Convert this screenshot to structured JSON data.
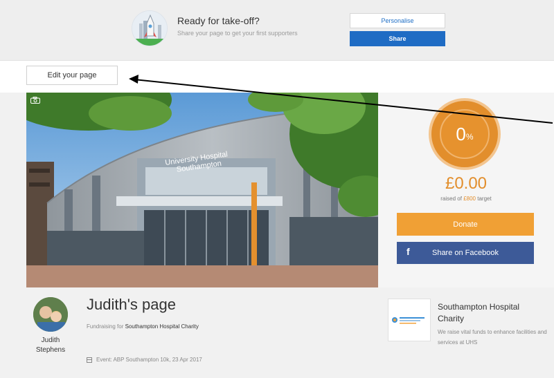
{
  "banner": {
    "title": "Ready for take-off?",
    "subtitle": "Share your page to get your first supporters",
    "personalise_label": "Personalise",
    "share_label": "Share"
  },
  "editbar": {
    "edit_label": "Edit your page"
  },
  "hero": {
    "building_sign_line1": "University Hospital",
    "building_sign_line2": "Southampton"
  },
  "stats": {
    "percent": "0",
    "percent_symbol": "%",
    "amount": "£0.00",
    "raised_prefix": "raised of",
    "target": "£800",
    "raised_suffix": "target",
    "donate_label": "Donate",
    "facebook_label": "Share on Facebook",
    "facebook_glyph": "f"
  },
  "profile": {
    "owner_name": "Judith Stephens",
    "page_title": "Judith's page",
    "fund_prefix": "Fundraising for",
    "charity": "Southampton Hospital Charity",
    "event": "Event: ABP Southampton 10k, 23 Apr 2017"
  },
  "charity_card": {
    "name": "Southampton Hospital Charity",
    "description": "We raise vital funds to enhance facilities and services at UHS"
  },
  "colors": {
    "accent_orange": "#e28e2c",
    "share_blue": "#1f6cc4",
    "facebook_blue": "#3d5a98"
  }
}
